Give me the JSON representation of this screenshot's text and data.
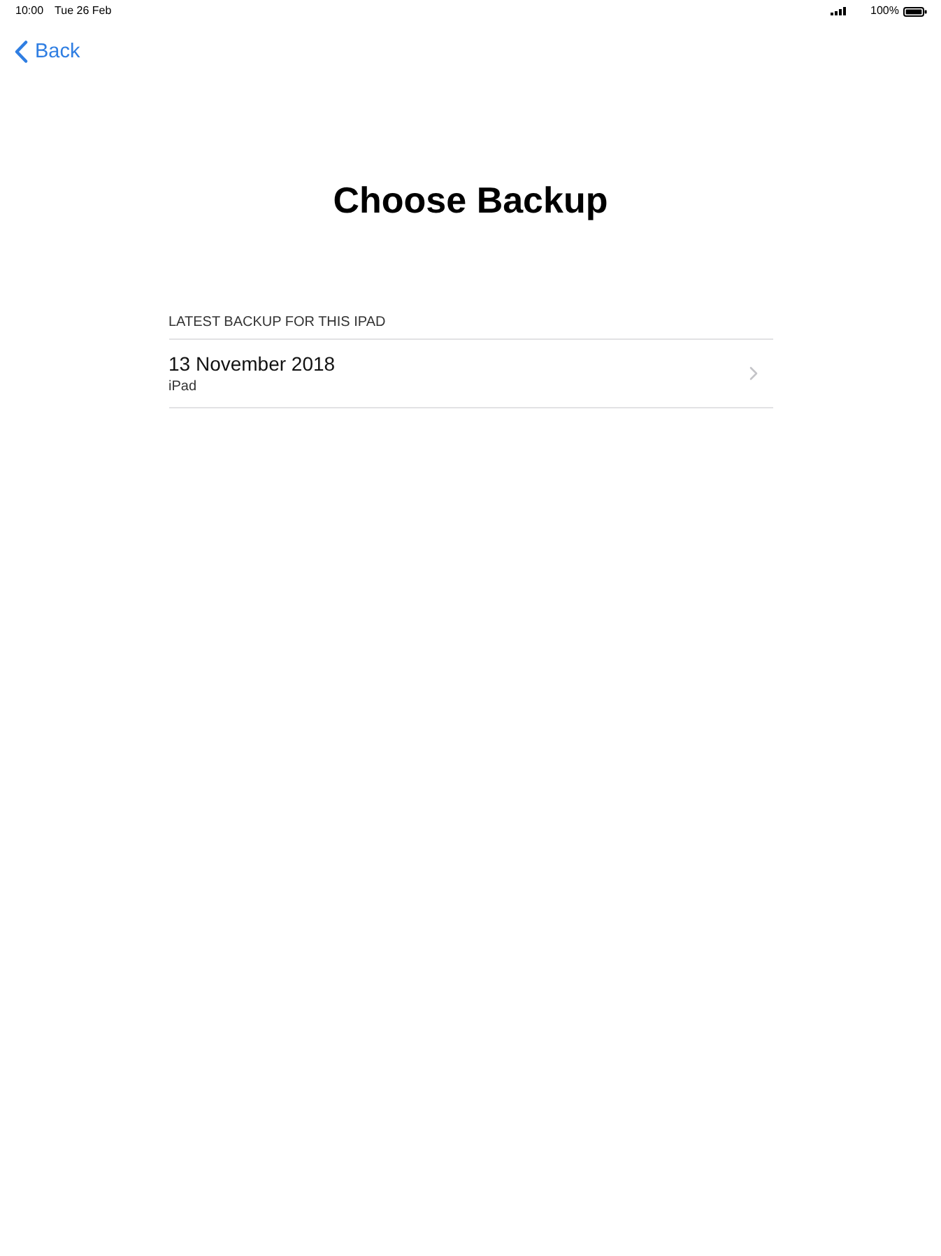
{
  "status_bar": {
    "time": "10:00",
    "date": "Tue 26 Feb",
    "battery_text": "100%"
  },
  "nav": {
    "back": "Back"
  },
  "title": "Choose Backup",
  "sections": [
    {
      "header": "LATEST BACKUP FOR THIS IPAD",
      "items": [
        {
          "title": "13 November 2018",
          "subtitle": "iPad"
        }
      ]
    }
  ]
}
